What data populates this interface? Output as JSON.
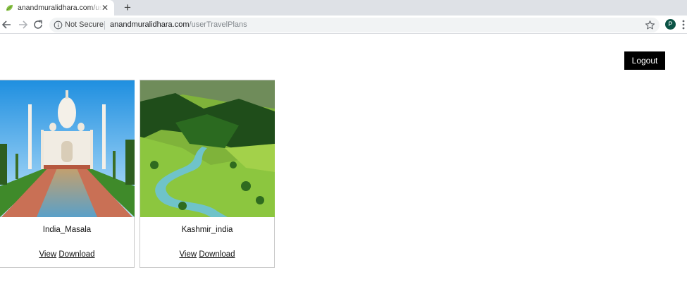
{
  "browser": {
    "tab_title": "anandmuralidhara.com/userTravelPlans",
    "tab_close": "✕",
    "new_tab": "+",
    "security_label": "Not Secure",
    "url_host": "anandmuralidhara.com",
    "url_path": "/userTravelPlans",
    "profile_initial": "P"
  },
  "page": {
    "logout_label": "Logout",
    "plans": [
      {
        "title": "India_Masala",
        "view_label": "View",
        "download_label": "Download"
      },
      {
        "title": "Kashmir_india",
        "view_label": "View",
        "download_label": "Download"
      }
    ]
  },
  "colors": {
    "tabstrip": "#dee1e6",
    "omnibox": "#f1f3f4",
    "logout_bg": "#000000",
    "avatar": "#0b5345"
  },
  "icons": [
    "favicon-leaf-icon",
    "close-icon",
    "plus-icon",
    "back-arrow-icon",
    "forward-arrow-icon",
    "reload-icon",
    "info-icon",
    "star-icon",
    "kebab-menu-icon"
  ]
}
